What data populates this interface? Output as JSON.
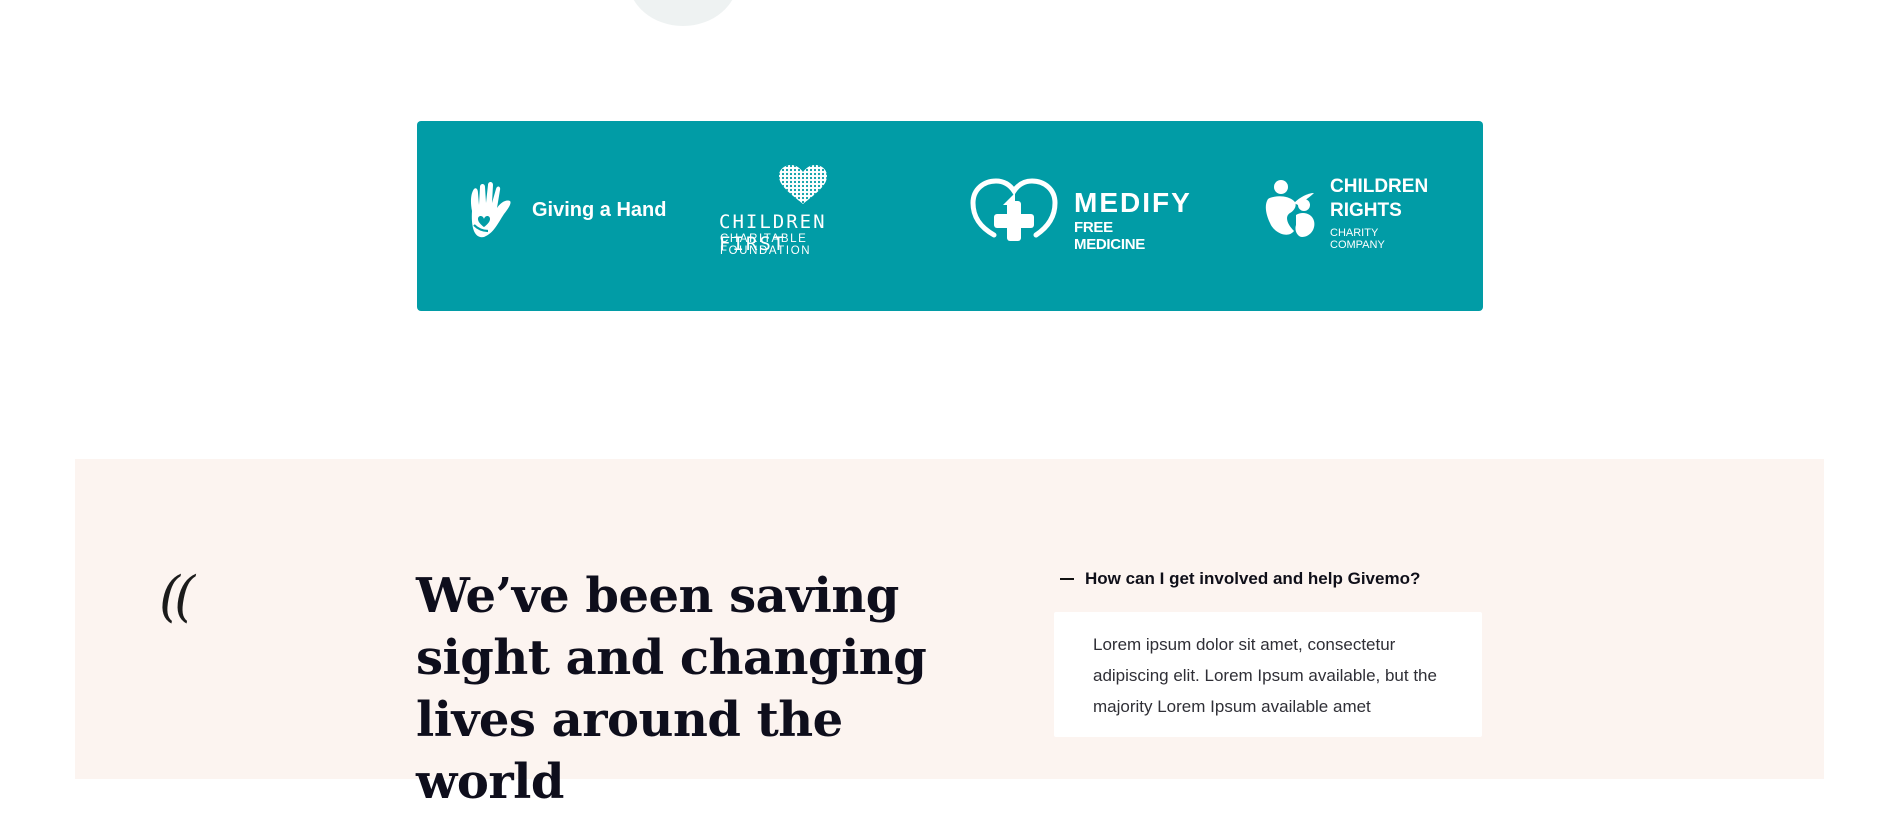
{
  "partners": [
    {
      "name": "Giving a Hand",
      "icon": "helping-hand-icon"
    },
    {
      "name": "CHILDREN FIRST",
      "tagline": "CHARITABLE FOUNDATION",
      "icon": "heart-icon"
    },
    {
      "name": "MEDIFY",
      "tagline": "FREE MEDICINE",
      "icon": "heart-cross-icon"
    },
    {
      "name": "CHILDREN RIGHTS",
      "tagline": "CHARITY COMPANY",
      "icon": "parent-child-icon"
    }
  ],
  "testimonial": {
    "quote_mark": "((",
    "headline": "We’ve been saving sight and changing lives around the world"
  },
  "faq": {
    "question": "How can I get involved and help Givemo?",
    "answer": "Lorem ipsum dolor sit amet, consectetur adipiscing elit. Lorem Ipsum available, but the majority Lorem Ipsum available amet"
  },
  "colors": {
    "partner_band": "#019ca6",
    "faq_background": "#fcf4f0",
    "faq_card": "#ffffff"
  }
}
